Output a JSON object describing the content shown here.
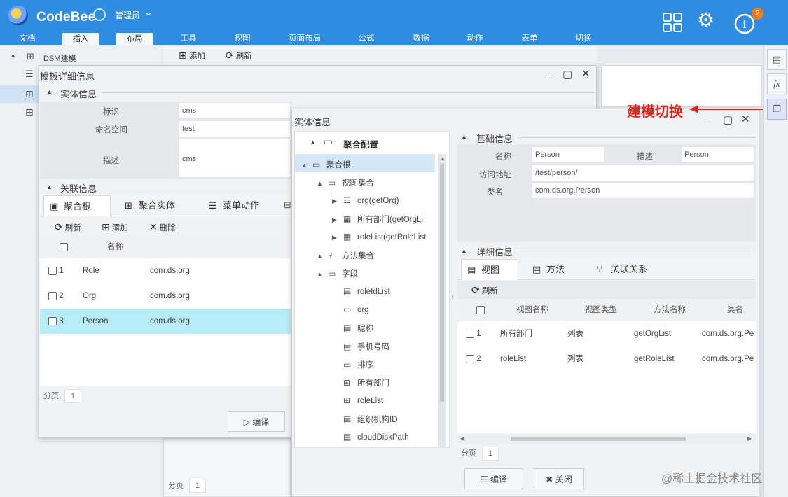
{
  "app": {
    "brand": "CodeBee",
    "user": "管理员",
    "notification_count": "2",
    "accent": "#2f8ce0"
  },
  "menu": [
    "文档",
    "插入",
    "布局",
    "工具",
    "视图",
    "页面布局",
    "公式",
    "数据",
    "动作",
    "表单",
    "切换"
  ],
  "left_tree": {
    "root_label": "DSM建模",
    "toolbar_add": "添加",
    "toolbar_refresh": "刷新",
    "pager_label": "分页",
    "pager_page": "1"
  },
  "template_window": {
    "title": "模板详细信息",
    "entity_section": "实体信息",
    "fields": [
      {
        "label": "标识",
        "value": "cms"
      },
      {
        "label": "命名空间",
        "value": "test"
      },
      {
        "label": "描述",
        "value": "cms"
      }
    ],
    "relation_section": "关联信息",
    "tabs": [
      "聚合根",
      "聚合实体",
      "菜单动作"
    ],
    "toolbar": {
      "refresh": "刷新",
      "add": "添加",
      "delete": "删除"
    },
    "grid_header": "名称",
    "rows": [
      {
        "num": "1",
        "name": "Role",
        "ns": "com.ds.org",
        "selected": false
      },
      {
        "num": "2",
        "name": "Org",
        "ns": "com.ds.org",
        "selected": false
      },
      {
        "num": "3",
        "name": "Person",
        "ns": "com.ds.org",
        "selected": true
      }
    ],
    "pager_label": "分页",
    "pager_page": "1",
    "edit_button": "编译"
  },
  "entity_window": {
    "title": "实体信息",
    "tree_header": "聚合配置",
    "tree": [
      {
        "label": "聚合根",
        "icon": "window-icon",
        "level": 0,
        "arrow": "▲",
        "selected": true
      },
      {
        "label": "视图集合",
        "icon": "window-icon",
        "level": 1,
        "arrow": "▲"
      },
      {
        "label": "org(getOrg)",
        "icon": "list-icon",
        "level": 2,
        "arrow": "▶"
      },
      {
        "label": "所有部门(getOrgLi",
        "icon": "table-icon",
        "level": 2,
        "arrow": "▶"
      },
      {
        "label": "roleList(getRoleList",
        "icon": "table-icon",
        "level": 2,
        "arrow": "▶"
      },
      {
        "label": "方法集合",
        "icon": "branch-icon",
        "level": 1,
        "arrow": "▲"
      },
      {
        "label": "字段",
        "icon": "field-icon",
        "level": 1,
        "arrow": "▲"
      },
      {
        "label": "roleIdList",
        "icon": "text-field-icon",
        "level": 2
      },
      {
        "label": "org",
        "icon": "field-icon",
        "level": 2
      },
      {
        "label": "昵称",
        "icon": "text-field-icon",
        "level": 2
      },
      {
        "label": "手机号码",
        "icon": "text-field-icon",
        "level": 2
      },
      {
        "label": "排序",
        "icon": "field-icon",
        "level": 2
      },
      {
        "label": "所有部门",
        "icon": "grid-icon",
        "level": 2
      },
      {
        "label": "roleList",
        "icon": "grid-icon",
        "level": 2
      },
      {
        "label": "组织机构ID",
        "icon": "text-field-icon",
        "level": 2
      },
      {
        "label": "cloudDiskPath",
        "icon": "text-field-icon",
        "level": 2
      }
    ],
    "basic_section": "基础信息",
    "basic": {
      "name_label": "名称",
      "name_value": "Person",
      "desc_label": "描述",
      "desc_value": "Person",
      "url_label": "访问地址",
      "url_value": "/test/person/",
      "class_label": "类名",
      "class_value": "com.ds.org.Person"
    },
    "detail_section": "详细信息",
    "detail_tabs": [
      "视图",
      "方法",
      "关联关系"
    ],
    "refresh": "刷新",
    "grid_headers": [
      "视图名称",
      "视图类型",
      "方法名称",
      "类名"
    ],
    "rows": [
      {
        "num": "1",
        "view": "所有部门",
        "type": "列表",
        "method": "getOrgList",
        "cls": "com.ds.org.Pe"
      },
      {
        "num": "2",
        "view": "roleList",
        "type": "列表",
        "method": "getRoleList",
        "cls": "com.ds.org.Pe"
      }
    ],
    "pager_label": "分页",
    "pager_page": "1",
    "compile_button": "编译",
    "close_button": "关闭"
  },
  "annotation": "建模切换",
  "watermark": "@稀土掘金技术社区"
}
